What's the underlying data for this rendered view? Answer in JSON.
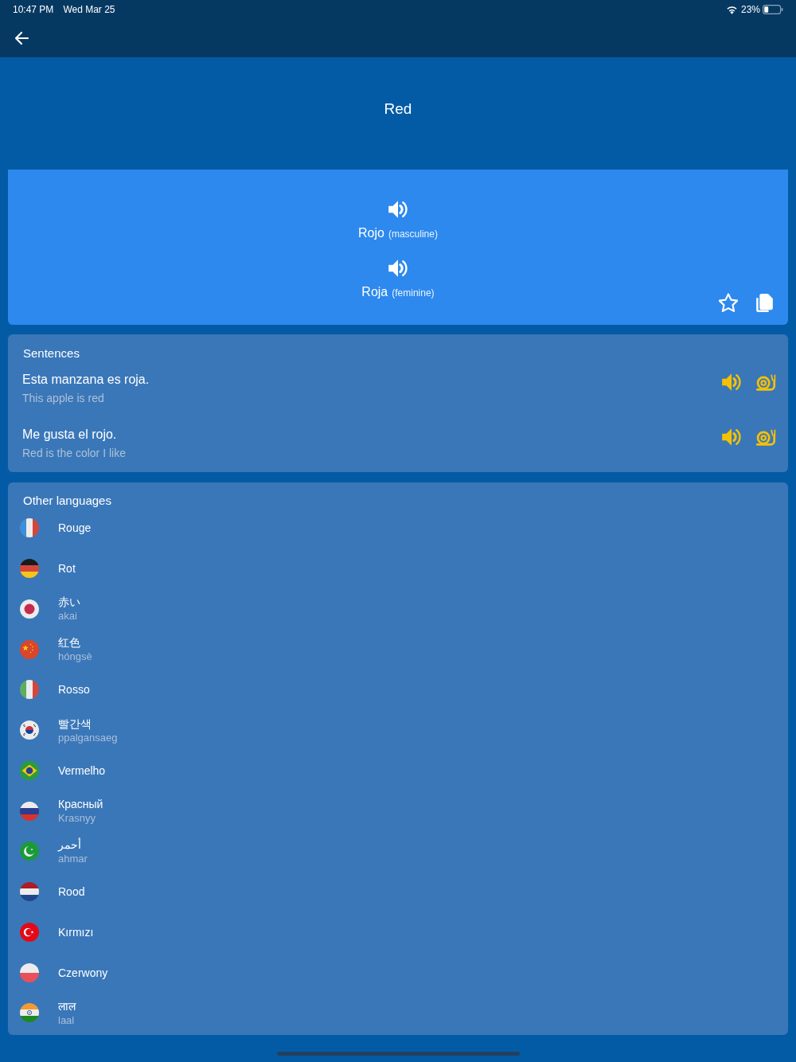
{
  "status_bar": {
    "time": "10:47 PM",
    "date": "Wed Mar 25",
    "battery_percent": "23%"
  },
  "header": {
    "title": "Red"
  },
  "word_card": {
    "forms": [
      {
        "word": "Rojo",
        "note": "(masculine)"
      },
      {
        "word": "Roja",
        "note": "(feminine)"
      }
    ]
  },
  "sentences": {
    "title": "Sentences",
    "items": [
      {
        "text": "Esta manzana es roja.",
        "translation": "This apple is red"
      },
      {
        "text": "Me gusta el rojo.",
        "translation": "Red is the color I like"
      }
    ]
  },
  "other_languages": {
    "title": "Other languages",
    "items": [
      {
        "kind": "france",
        "word": "Rouge"
      },
      {
        "kind": "germany",
        "word": "Rot"
      },
      {
        "kind": "japan",
        "word": "赤い",
        "romanization": "akai"
      },
      {
        "kind": "china",
        "word": "红色",
        "romanization": "hóngsè"
      },
      {
        "kind": "italy",
        "word": "Rosso"
      },
      {
        "kind": "korea",
        "word": "빨간색",
        "romanization": "ppalgansaeg"
      },
      {
        "kind": "brazil",
        "word": "Vermelho"
      },
      {
        "kind": "russia",
        "word": "Красный",
        "romanization": "Krasnyy"
      },
      {
        "kind": "crescent",
        "word": "أحمر",
        "romanization": "ahmar"
      },
      {
        "kind": "netherlands",
        "word": "Rood"
      },
      {
        "kind": "turkey",
        "word": "Kırmızı"
      },
      {
        "kind": "poland",
        "word": "Czerwony"
      },
      {
        "kind": "india",
        "word": "लाल",
        "romanization": "laal"
      }
    ]
  }
}
